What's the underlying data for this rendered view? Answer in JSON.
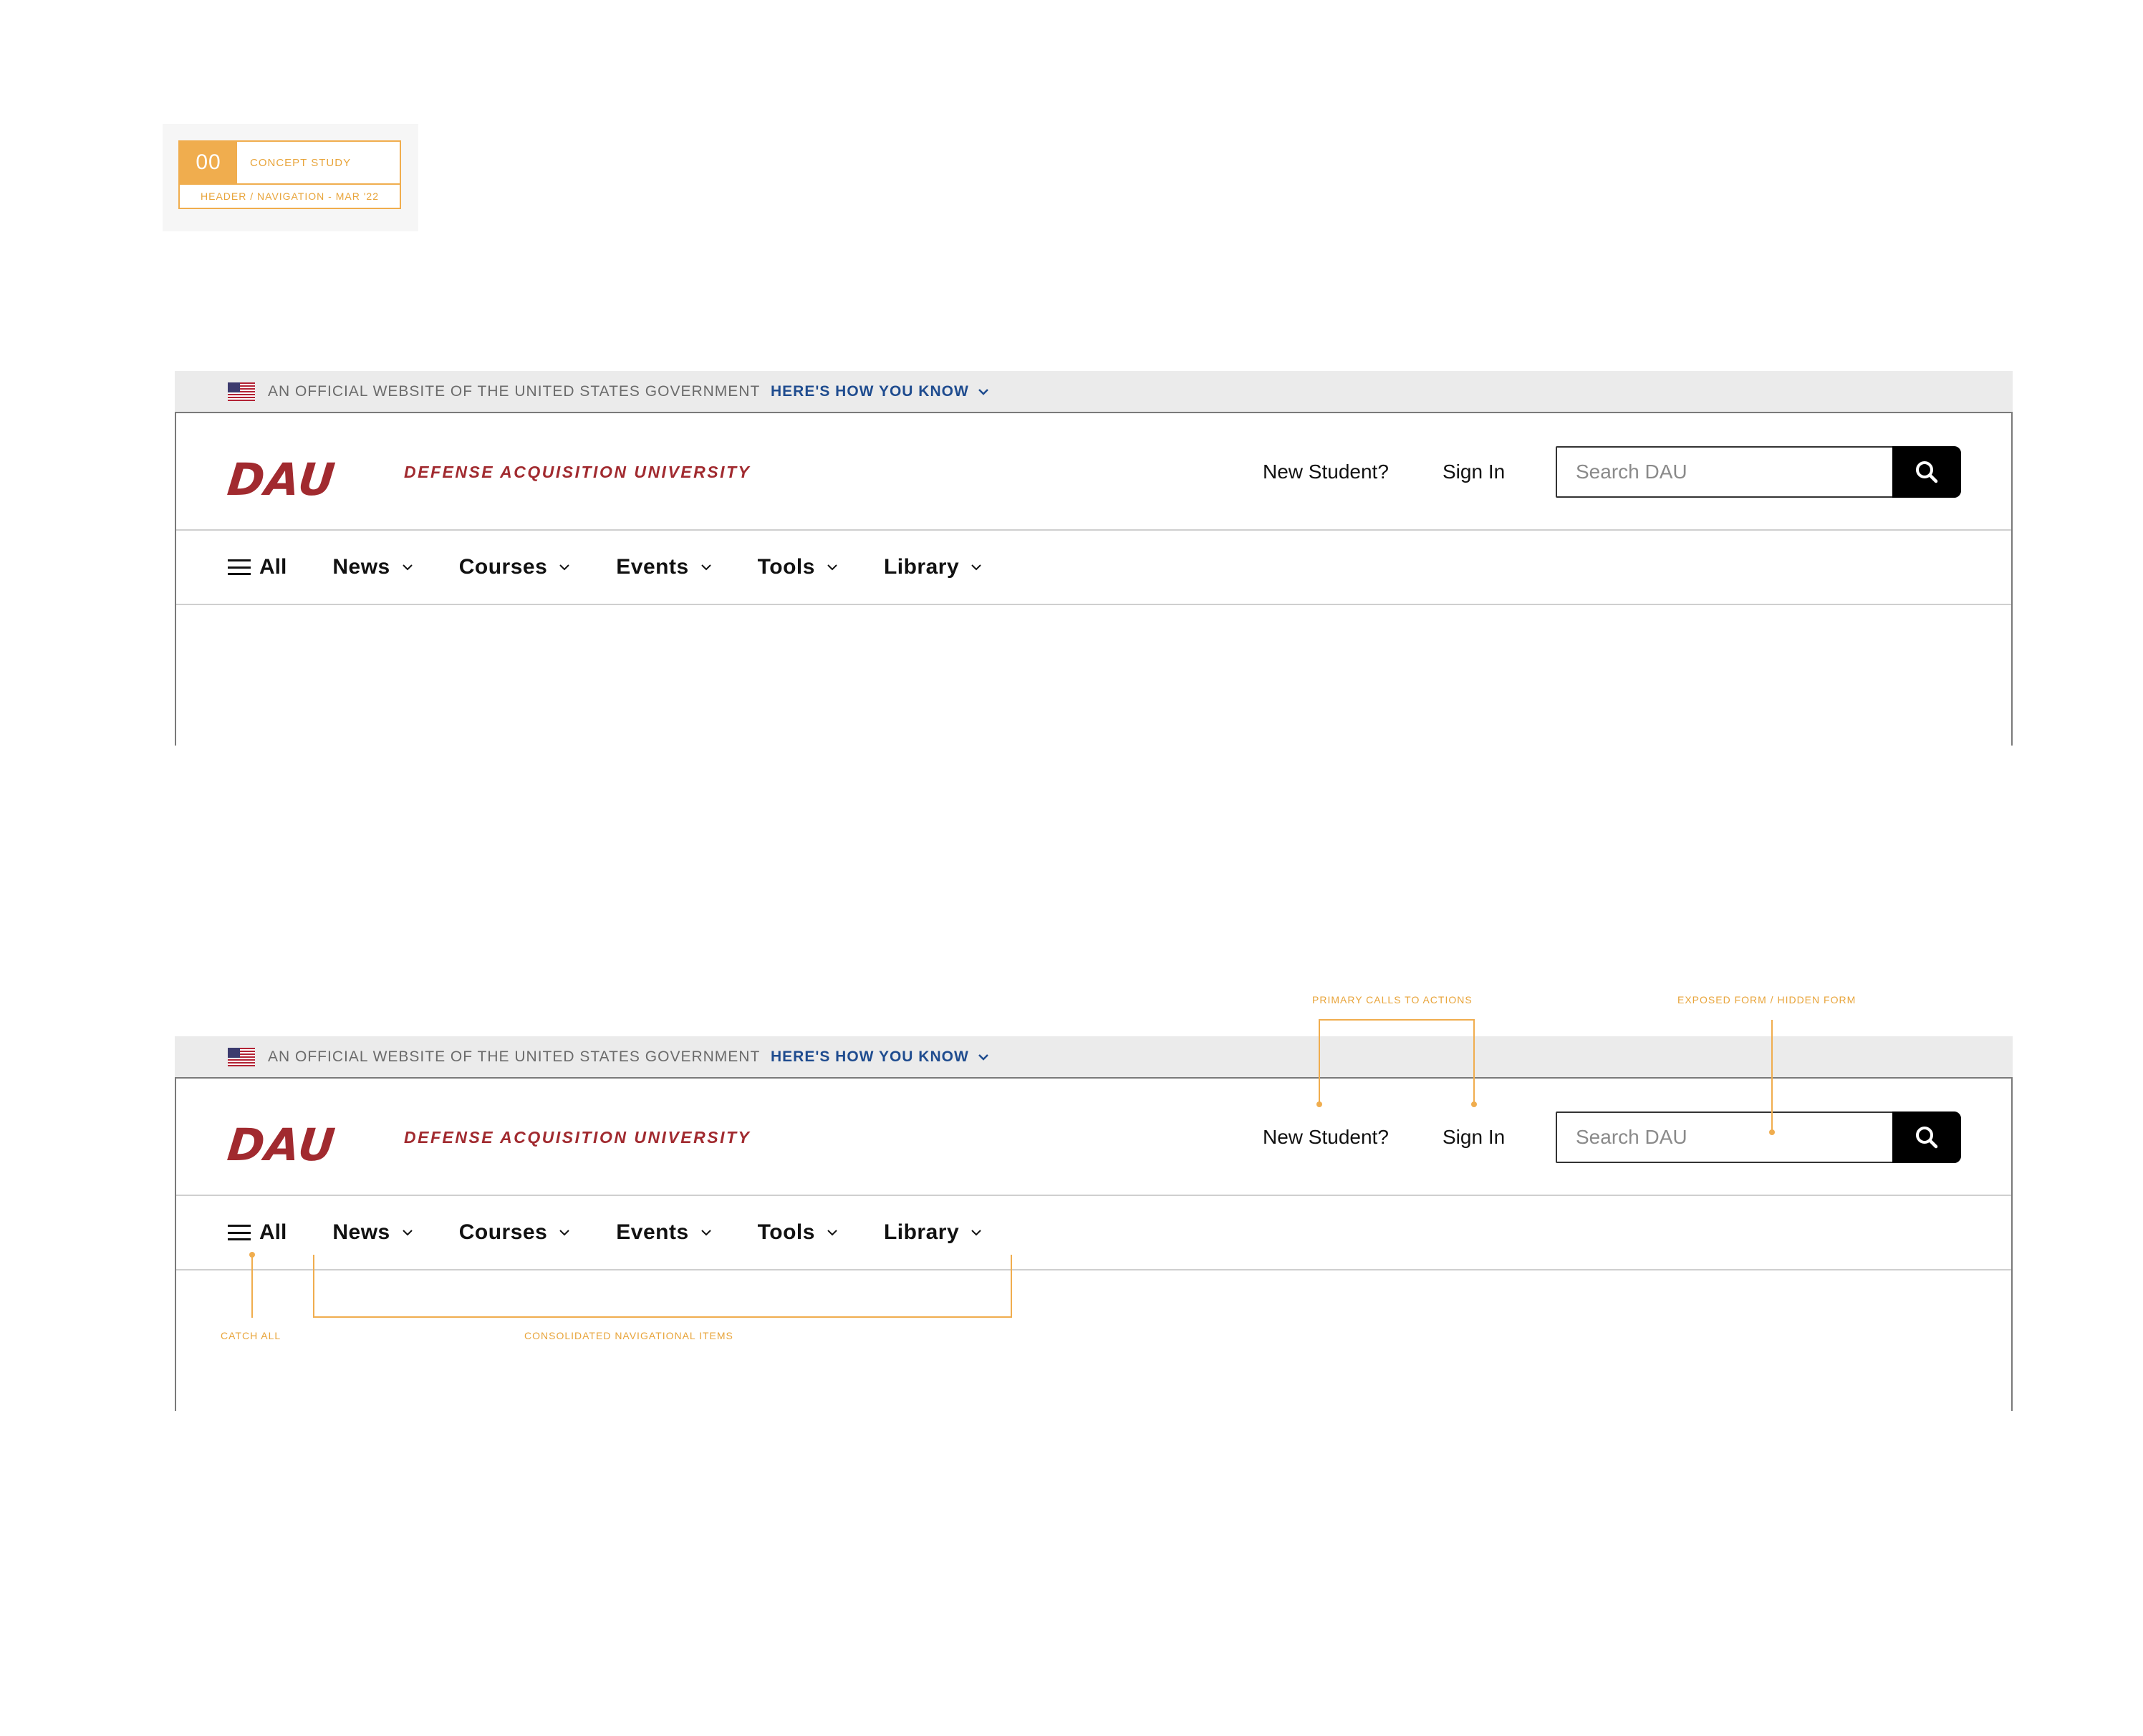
{
  "concept": {
    "number": "00",
    "kind": "Concept Study",
    "subtitle": "Header / Navigation - Mar '22"
  },
  "gov_banner": {
    "text": "An official website of the United States government",
    "link": "Here's how you know"
  },
  "header": {
    "logo": "DAU",
    "university": "Defense Acquisition University",
    "new_student": "New Student?",
    "sign_in": "Sign In",
    "search_placeholder": "Search DAU"
  },
  "nav": {
    "all": "All",
    "items": [
      "News",
      "Courses",
      "Events",
      "Tools",
      "Library"
    ]
  },
  "annotations": {
    "primary_cta": "Primary calls to actions",
    "exposed_form": "Exposed form / hidden form",
    "catch_all": "Catch all",
    "consolidated": "Consolidated navigational items"
  },
  "colors": {
    "brand_red": "#a12a2f",
    "link_blue": "#1f4c8f",
    "annotation_orange": "#f0ad4e"
  }
}
